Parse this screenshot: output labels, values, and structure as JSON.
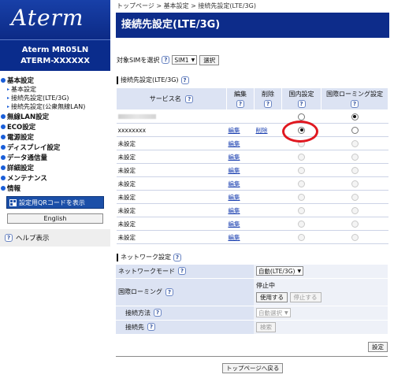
{
  "sidebar": {
    "logo": "Aterm",
    "model_line1": "Aterm   MR05LN",
    "model_line2": "ATERM-XXXXXX",
    "nav": {
      "basic": "基本設定",
      "basic_sub1": "基本設定",
      "basic_sub2": "接続先設定(LTE/3G)",
      "basic_sub3": "接続先設定(公衆無線LAN)",
      "wlan": "無線LAN設定",
      "eco": "ECO設定",
      "power": "電源設定",
      "display": "ディスプレイ設定",
      "data": "データ通信量",
      "detail": "詳細設定",
      "maintenance": "メンテナンス",
      "info": "情報"
    },
    "qr_button": "設定用QRコードを表示",
    "english_button": "English",
    "help": "ヘルプ表示"
  },
  "breadcrumb": "トップページ > 基本設定 > 接続先設定(LTE/3G)",
  "page_title": "接続先設定(LTE/3G)",
  "sim_select": {
    "label": "対象SIMを選択",
    "value": "SIM1",
    "button": "選択"
  },
  "services": {
    "section_title": "接続先設定(LTE/3G)",
    "headers": {
      "name": "サービス名",
      "edit": "編集",
      "delete": "削除",
      "domestic": "国内設定",
      "roaming": "国際ローミング設定"
    },
    "edit_link": "編集",
    "delete_link": "削除",
    "unset": "未設定",
    "row2_name": "xxxxxxxx"
  },
  "network": {
    "section_title": "ネットワーク設定",
    "mode_label": "ネットワークモード",
    "mode_value": "自動(LTE/3G)",
    "roaming_label": "国際ローミング",
    "roaming_status": "停止中",
    "roaming_use": "使用する",
    "roaming_stop": "停止する",
    "method_label": "接続方法",
    "method_value": "自動選択",
    "dest_label": "接続先",
    "search_button": "検索"
  },
  "set_button": "設定",
  "back_button": "トップページへ戻る",
  "colors": {
    "brand_navy": "#0d2c8a",
    "header_blue": "#dce3f3",
    "link_blue": "#1a3fb0",
    "highlight_red": "#e01820"
  },
  "icons": {
    "help": "question-mark-icon",
    "bullet": "blue-dot-icon",
    "qr": "qr-code-icon"
  }
}
